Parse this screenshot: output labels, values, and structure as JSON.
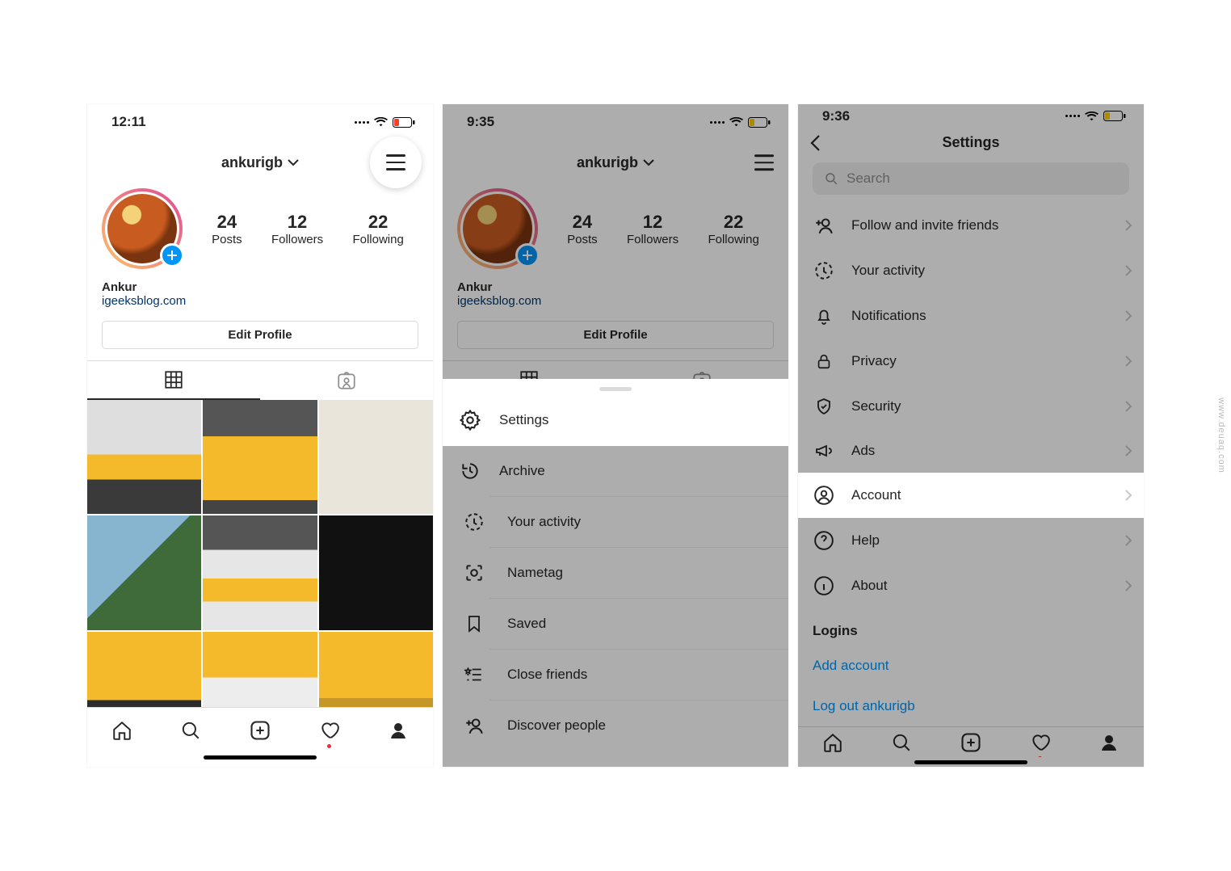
{
  "watermark": "www.deuaq.com",
  "panel1": {
    "time": "12:11",
    "username": "ankurigb",
    "stats": {
      "posts_n": "24",
      "posts_l": "Posts",
      "followers_n": "12",
      "followers_l": "Followers",
      "following_n": "22",
      "following_l": "Following"
    },
    "bio_name": "Ankur",
    "bio_link": "igeeksblog.com",
    "edit_profile": "Edit Profile",
    "tiles": [
      {
        "bg": "linear-gradient(180deg,#dedede 0 48%, #f4ba2b 48% 70%, #3a3a3a 70%)"
      },
      {
        "bg": "linear-gradient(180deg,#555 0 32%, #f4ba2b 32% 88%, #444 88%)"
      },
      {
        "bg": "linear-gradient(180deg,#e9e5da 0 100%)"
      },
      {
        "bg": "linear-gradient(135deg,#87b5cf 0 45%, #3f6b3b 45% 100%)"
      },
      {
        "bg": "linear-gradient(180deg,#555 0 30%, #e6e6e6 30% 55%, #f4ba2b 55% 75%, #e6e6e6 75%)"
      },
      {
        "bg": "linear-gradient(180deg,#111 0 100%)"
      },
      {
        "bg": "linear-gradient(180deg,#f4ba2b 0 60%, #2c2c2c 60%)"
      },
      {
        "bg": "linear-gradient(180deg,#f4ba2b 0 40%, #ededed 40% 70%, #f4ba2b 70%)"
      },
      {
        "bg": "linear-gradient(180deg,#f4ba2b 0 58%, #c49728 58%)",
        "like": "1"
      },
      {
        "bg": "linear-gradient(180deg,#f2f2f2 0 100%)"
      },
      {
        "bg": "linear-gradient(180deg,#f4ba2b 0 100%)"
      },
      {
        "bg": "linear-gradient(180deg,#f4ba2b 0 100%)"
      }
    ]
  },
  "panel2": {
    "time": "9:35",
    "username": "ankurigb",
    "stats": {
      "posts_n": "24",
      "posts_l": "Posts",
      "followers_n": "12",
      "followers_l": "Followers",
      "following_n": "22",
      "following_l": "Following"
    },
    "bio_name": "Ankur",
    "bio_link": "igeeksblog.com",
    "edit_profile": "Edit Profile",
    "menu": {
      "settings": "Settings",
      "archive": "Archive",
      "activity": "Your activity",
      "nametag": "Nametag",
      "saved": "Saved",
      "close_friends": "Close friends",
      "discover": "Discover people"
    }
  },
  "panel3": {
    "time": "9:36",
    "title": "Settings",
    "search_placeholder": "Search",
    "items": {
      "follow": "Follow and invite friends",
      "activity": "Your activity",
      "notifications": "Notifications",
      "privacy": "Privacy",
      "security": "Security",
      "ads": "Ads",
      "account": "Account",
      "help": "Help",
      "about": "About"
    },
    "logins_label": "Logins",
    "add_account": "Add account",
    "logout": "Log out ankurigb"
  }
}
